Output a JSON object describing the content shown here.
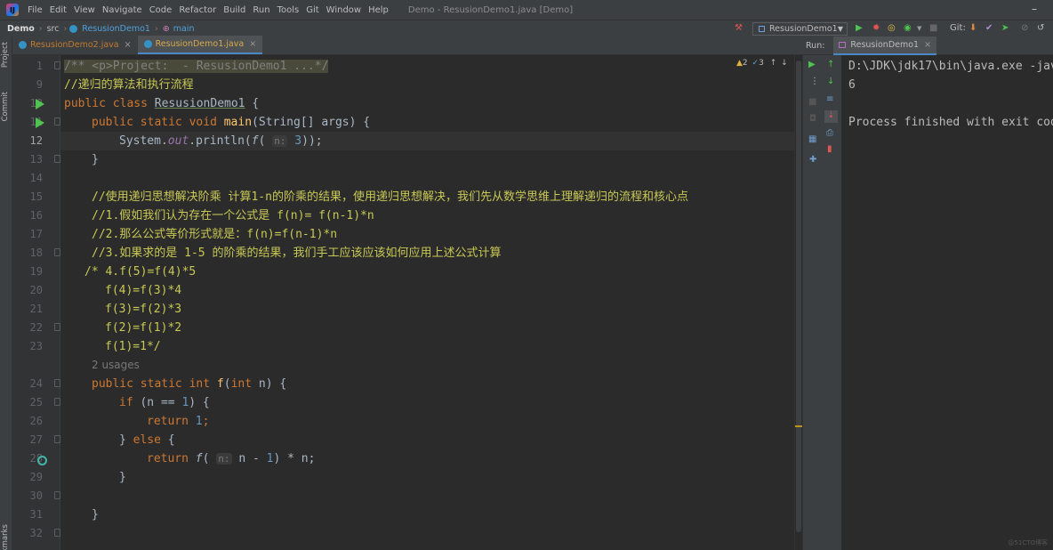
{
  "menubar": {
    "items": [
      "File",
      "Edit",
      "View",
      "Navigate",
      "Code",
      "Refactor",
      "Build",
      "Run",
      "Tools",
      "Git",
      "Window",
      "Help"
    ],
    "window_title": "Demo - ResusionDemo1.java [Demo]",
    "minimize": "–"
  },
  "navbar": {
    "project": "Demo",
    "src": "src",
    "class": "ResusionDemo1",
    "method": "main",
    "run_config": "ResusionDemo1",
    "git_label": "Git:"
  },
  "left_strip": {
    "project_tab": "Project",
    "commit_tab": "Commit",
    "bookmarks_tab": "Bookmarks"
  },
  "tabs": [
    {
      "label": "ResusionDemo2.java",
      "active": false
    },
    {
      "label": "ResusionDemo1.java",
      "active": true
    }
  ],
  "inspections": {
    "warnings": "2",
    "typos": "3"
  },
  "code": {
    "line_numbers": [
      "1",
      "9",
      "10",
      "11",
      "12",
      "13",
      "14",
      "15",
      "16",
      "17",
      "18",
      "19",
      "20",
      "21",
      "22",
      "23",
      "24",
      "25",
      "26",
      "27",
      "28",
      "29",
      "30",
      "31",
      "32"
    ],
    "folded_header": "/** <p>Project:  - ResusionDemo1 ...*/",
    "comment_title": "//递归的算法和执行流程",
    "kw_public": "public",
    "kw_class": "class",
    "class_name": "ResusionDemo1",
    "brace_open": " {",
    "kw_static": "static",
    "kw_void": "void",
    "main_name": "main",
    "main_params": "(String[] args) {",
    "sysout": "System.",
    "out_field": "out",
    "println": ".println(",
    "f_call": "f",
    "paren_open": "(",
    "hint_n": "n:",
    "arg_3": "3",
    "close_call": "));",
    "close_brace": "}",
    "c15": "//使用递归思想解决阶乘 计算1-n的阶乘的结果，使用递归思想解决，我们先从数学思维上理解递归的流程和核心点",
    "c16": "//1.假如我们认为存在一个公式是 f(n)= f(n-1)*n",
    "c17": "//2.那么公式等价形式就是：f(n)=f(n-1)*n",
    "c18": "//3.如果求的是 1-5 的阶乘的结果，我们手工应该应该如何应用上述公式计算",
    "c19": "/* 4.f(5)=f(4)*5",
    "c20": "f(4)=f(3)*4",
    "c21": "f(3)=f(2)*3",
    "c22": "f(2)=f(1)*2",
    "c23": "f(1)=1*/",
    "usages": "2 usages",
    "kw_int": "int",
    "f_name": "f",
    "f_params_open": "(",
    "f_params_close": " n) {",
    "kw_if": "if",
    "if_cond": " (n == ",
    "one": "1",
    "if_close": ") {",
    "kw_return": "return",
    "semicolon": ";",
    "else_open": "} ",
    "kw_else": "else",
    "return_expr_tail": " n - ",
    "return_close": ") * n;"
  },
  "run_panel": {
    "label": "Run:",
    "tab": "ResusionDemo1",
    "output": [
      "D:\\JDK\\jdk17\\bin\\java.exe -jav",
      "6",
      "",
      "Process finished with exit cod"
    ]
  },
  "watermark": "@51CTO博客",
  "colors": {
    "keyword": "#cc7832",
    "comment": "#808080",
    "number": "#6897bb",
    "function": "#ffc66d",
    "static_field": "#9876aa",
    "run_green": "#4fc34f"
  }
}
